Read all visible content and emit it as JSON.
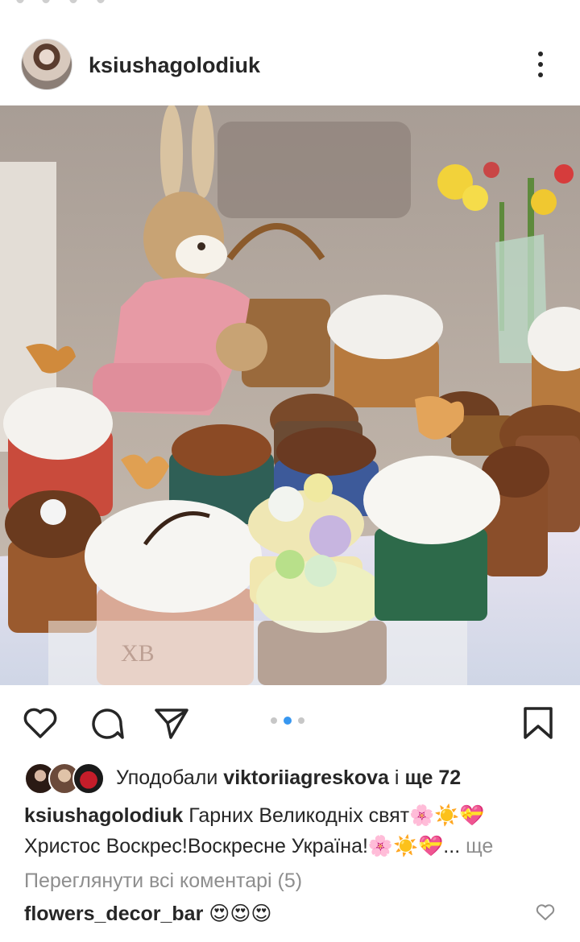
{
  "post": {
    "username": "ksiushagolodiuk",
    "more_icon": "more-vertical-icon"
  },
  "actions": {
    "like_icon": "heart-icon",
    "comment_icon": "comment-icon",
    "share_icon": "paper-plane-icon",
    "save_icon": "bookmark-icon",
    "carousel_total": 3,
    "carousel_active": 2
  },
  "likes": {
    "prefix": "Уподобали",
    "first_liker": "viktoriiagreskova",
    "connector": "і",
    "others": "ще 72"
  },
  "caption": {
    "username": "ksiushagolodiuk",
    "line1": "Гарних Великодніх свят🌸☀️💝",
    "line2": "Христос Воскрес!Воскресне Україна!🌸☀️💝...",
    "more_label": "ще"
  },
  "comments": {
    "view_all": "Переглянути всі коментарі (5)",
    "first_username": "flowers_decor_bar",
    "first_text": "😍😍😍"
  },
  "colors": {
    "accent_blue": "#3897f0",
    "text": "#262626",
    "muted": "#8e8e8e"
  }
}
